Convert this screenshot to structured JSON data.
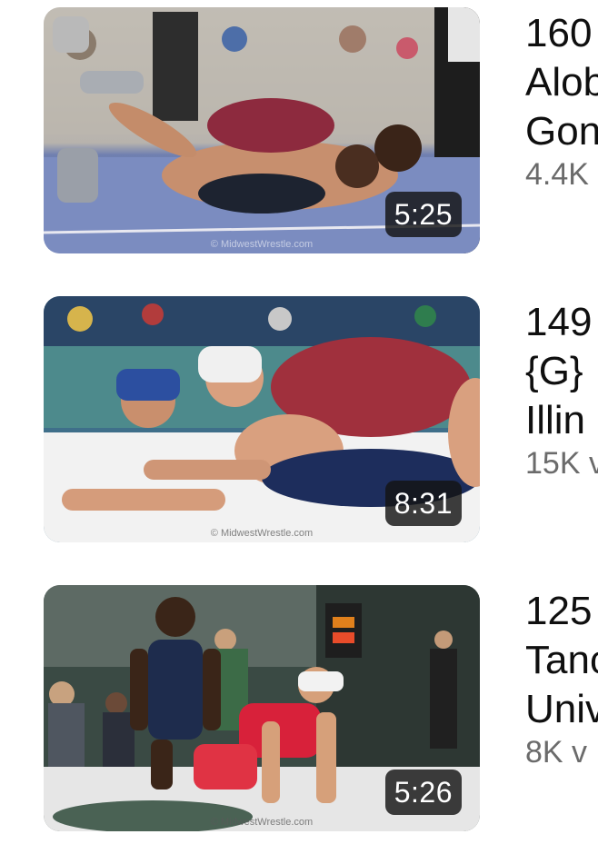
{
  "videos": [
    {
      "title_lines": [
        "160",
        "Alob",
        "Gon"
      ],
      "views": "4.4K",
      "duration": "5:25",
      "watermark": "© MidwestWrestle.com",
      "thumbnail_icon": "wrestling-photo-thumbnail"
    },
    {
      "title_lines": [
        "149",
        "{G}",
        "Illin"
      ],
      "views": "15K v",
      "duration": "8:31",
      "watermark": "© MidwestWrestle.com",
      "thumbnail_icon": "wrestling-photo-thumbnail"
    },
    {
      "title_lines": [
        "125",
        "Tanc",
        "Univ"
      ],
      "views": "8K v",
      "duration": "5:26",
      "watermark": "© MidwestWrestle.com",
      "thumbnail_icon": "wrestling-photo-thumbnail"
    }
  ]
}
